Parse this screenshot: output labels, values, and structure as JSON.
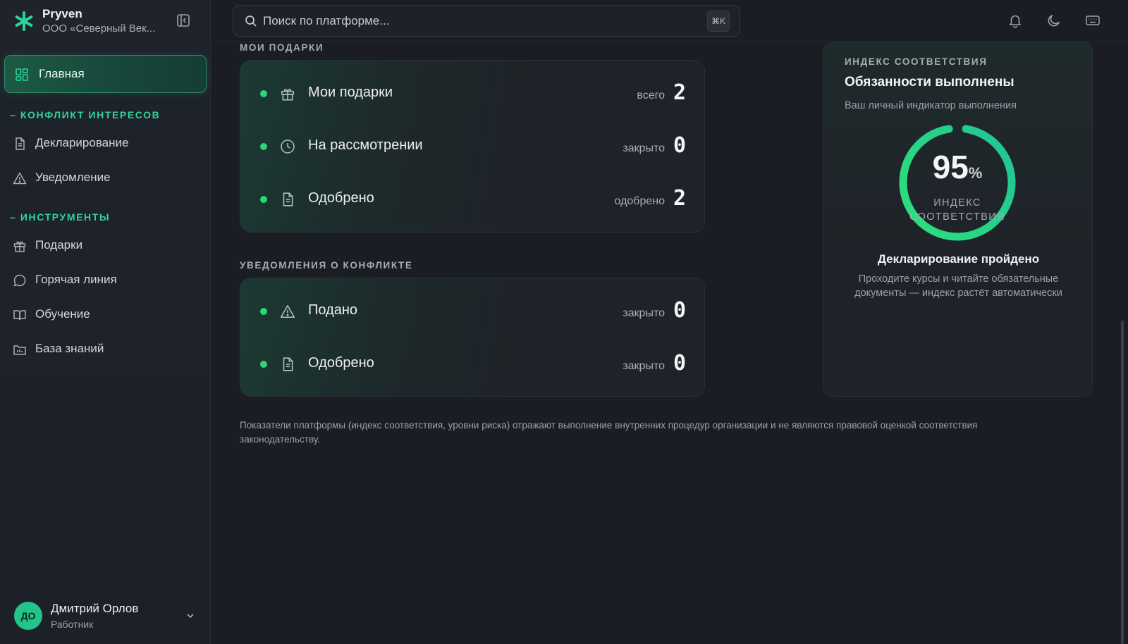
{
  "app": {
    "name": "Pryven",
    "org": "ООО «Северный Век..."
  },
  "sidebar": {
    "home_label": "Главная",
    "sections": [
      {
        "title": "– КОНФЛИКТ ИНТЕРЕСОВ",
        "items": [
          {
            "label": "Декларирование",
            "icon": "document-icon"
          },
          {
            "label": "Уведомление",
            "icon": "warning-icon"
          }
        ]
      },
      {
        "title": "– ИНСТРУМЕНТЫ",
        "items": [
          {
            "label": "Подарки",
            "icon": "gift-icon"
          },
          {
            "label": "Горячая линия",
            "icon": "chat-icon"
          },
          {
            "label": "Обучение",
            "icon": "book-icon"
          },
          {
            "label": "База знаний",
            "icon": "folder-icon"
          }
        ]
      }
    ]
  },
  "user": {
    "initials": "ДО",
    "name": "Дмитрий Орлов",
    "role": "Работник"
  },
  "search": {
    "placeholder": "Поиск по платформе...",
    "shortcut": "⌘K"
  },
  "gifts": {
    "title": "МОИ ПОДАРКИ",
    "rows": [
      {
        "label": "Мои подарки",
        "meta": "всего",
        "value": "2",
        "icon": "gift-icon"
      },
      {
        "label": "На рассмотрении",
        "meta": "закрыто",
        "value": "0",
        "icon": "clock-icon"
      },
      {
        "label": "Одобрено",
        "meta": "одобрено",
        "value": "2",
        "icon": "document-icon"
      }
    ]
  },
  "conflicts": {
    "title": "УВЕДОМЛЕНИЯ О КОНФЛИКТЕ",
    "rows": [
      {
        "label": "Подано",
        "meta": "закрыто",
        "value": "0",
        "icon": "warning-icon"
      },
      {
        "label": "Одобрено",
        "meta": "закрыто",
        "value": "0",
        "icon": "document-icon"
      }
    ]
  },
  "compliance": {
    "kicker": "ИНДЕКС СООТВЕТСТВИЯ",
    "title": "Обязанности выполнены",
    "subtitle": "Ваш личный индикатор выполнения",
    "value": 95,
    "value_text": "95",
    "unit": "%",
    "caption_line1": "ИНДЕКС",
    "caption_line2": "СООТВЕТСТВИЯ",
    "status": "Декларирование пройдено",
    "description": "Проходите курсы и читайте обязательные документы — индекс растёт автоматически"
  },
  "disclaimer": "Показатели платформы (индекс соответствия, уровни риска) отражают выполнение внутренних процедур организации и не являются правовой оценкой соответствия законодательству.",
  "colors": {
    "accent": "#2ed39a",
    "dot": "#2fd677",
    "background": "#1a1d24"
  }
}
